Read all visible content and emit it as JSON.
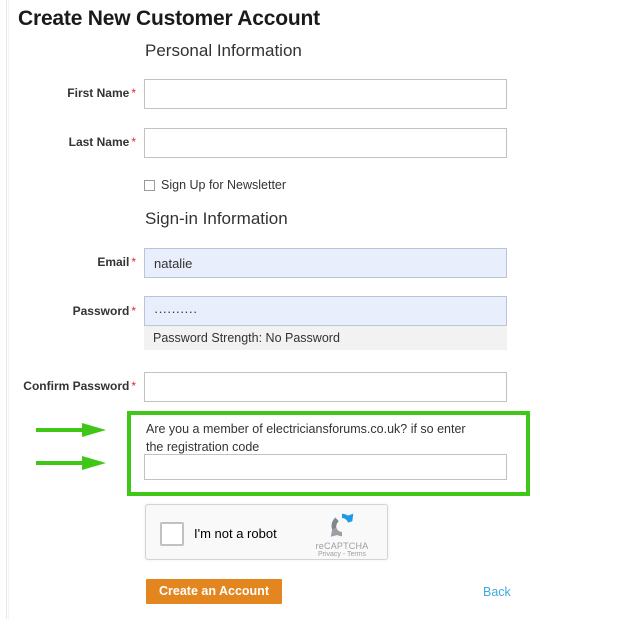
{
  "page": {
    "title": "Create New Customer Account"
  },
  "sections": {
    "personal": {
      "legend": "Personal Information"
    },
    "signin": {
      "legend": "Sign-in Information"
    }
  },
  "fields": {
    "first_name": {
      "label": "First Name",
      "required_marker": "*",
      "value": "",
      "placeholder": ""
    },
    "last_name": {
      "label": "Last Name",
      "required_marker": "*",
      "value": "",
      "placeholder": ""
    },
    "email": {
      "label": "Email",
      "required_marker": "*",
      "value": "natalie",
      "placeholder": ""
    },
    "password": {
      "label": "Password",
      "required_marker": "*",
      "value": "··········",
      "placeholder": "",
      "strength_text": "Password Strength: No Password"
    },
    "confirm_password": {
      "label": "Confirm Password",
      "required_marker": "*",
      "value": "",
      "placeholder": ""
    },
    "registration_code": {
      "value": "",
      "placeholder": ""
    }
  },
  "newsletter": {
    "label": "Sign Up for Newsletter",
    "checked": false
  },
  "callout": {
    "text": "Are you a member of electriciansforums.co.uk? if so enter the registration code",
    "highlight_color": "#3fc617",
    "arrow_color": "#3fc617"
  },
  "recaptcha": {
    "label": "I'm not a robot",
    "brand": "reCAPTCHA",
    "terms": "Privacy - Terms"
  },
  "actions": {
    "submit_label": "Create an Account",
    "submit_color": "#e48620",
    "back_label": "Back",
    "back_color": "#3fa9dd"
  }
}
